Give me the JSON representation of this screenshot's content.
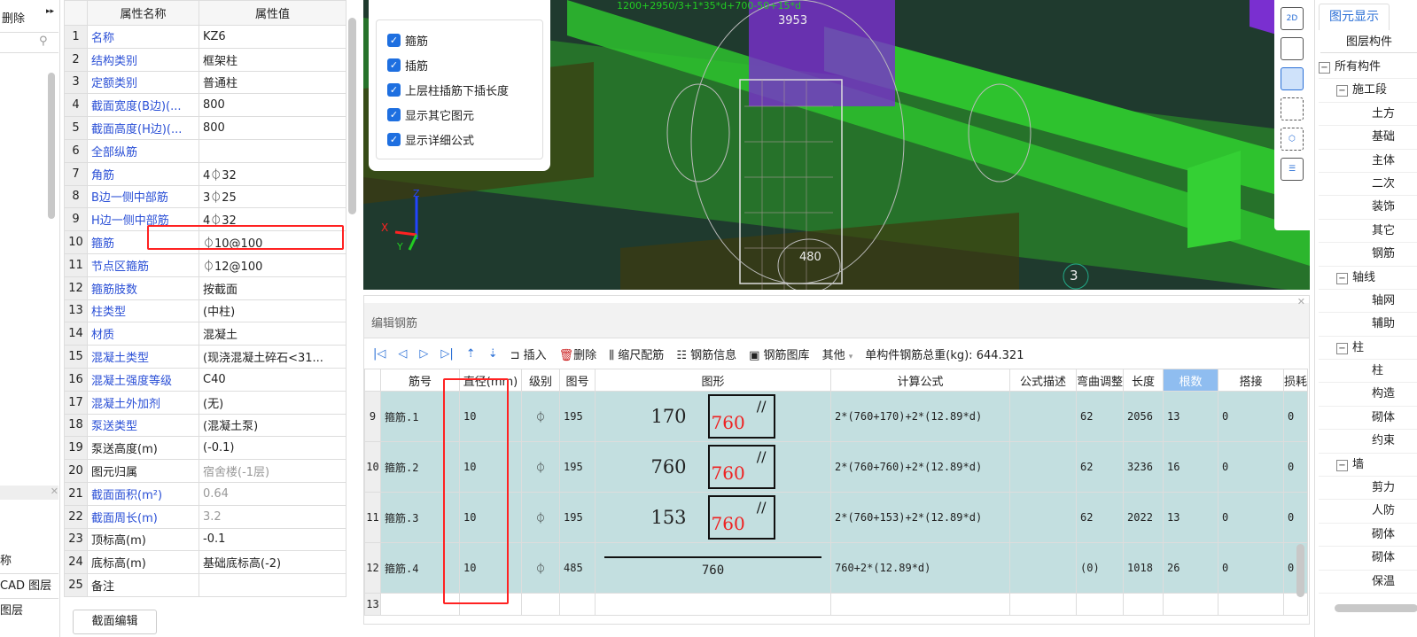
{
  "left_panel": {
    "delete_label": "删除",
    "bottom_items": [
      "称",
      "CAD 图层",
      "图层"
    ]
  },
  "props": {
    "headers": [
      "属性名称",
      "属性值"
    ],
    "rows": [
      {
        "n": "1",
        "name": "名称",
        "value": "KZ6",
        "blue": true
      },
      {
        "n": "2",
        "name": "结构类别",
        "value": "框架柱",
        "blue": true
      },
      {
        "n": "3",
        "name": "定额类别",
        "value": "普通柱",
        "blue": true
      },
      {
        "n": "4",
        "name": "截面宽度(B边)(...",
        "value": "800",
        "blue": true
      },
      {
        "n": "5",
        "name": "截面高度(H边)(...",
        "value": "800",
        "blue": true
      },
      {
        "n": "6",
        "name": "全部纵筋",
        "value": "",
        "blue": true
      },
      {
        "n": "7",
        "name": "角筋",
        "value": "4⏀32",
        "blue": true
      },
      {
        "n": "8",
        "name": "B边一侧中部筋",
        "value": "3⏀25",
        "blue": true
      },
      {
        "n": "9",
        "name": "H边一侧中部筋",
        "value": "4⏀32",
        "blue": true
      },
      {
        "n": "10",
        "name": "箍筋",
        "value": "⏀10@100",
        "blue": true
      },
      {
        "n": "11",
        "name": "节点区箍筋",
        "value": "⏀12@100",
        "blue": true
      },
      {
        "n": "12",
        "name": "箍筋肢数",
        "value": "按截面",
        "blue": true
      },
      {
        "n": "13",
        "name": "柱类型",
        "value": "(中柱)",
        "blue": true
      },
      {
        "n": "14",
        "name": "材质",
        "value": "混凝土",
        "blue": true
      },
      {
        "n": "15",
        "name": "混凝土类型",
        "value": "(现浇混凝土碎石<31...",
        "blue": true
      },
      {
        "n": "16",
        "name": "混凝土强度等级",
        "value": "C40",
        "blue": true
      },
      {
        "n": "17",
        "name": "混凝土外加剂",
        "value": "(无)",
        "blue": true
      },
      {
        "n": "18",
        "name": "泵送类型",
        "value": "(混凝土泵)",
        "blue": true
      },
      {
        "n": "19",
        "name": "泵送高度(m)",
        "value": "(-0.1)",
        "blue": false
      },
      {
        "n": "20",
        "name": "图元归属",
        "value": "宿舍楼(-1层)",
        "blue": false,
        "gray": true
      },
      {
        "n": "21",
        "name": "截面面积(m²)",
        "value": "0.64",
        "blue": true,
        "gray": true
      },
      {
        "n": "22",
        "name": "截面周长(m)",
        "value": "3.2",
        "blue": true,
        "gray": true
      },
      {
        "n": "23",
        "name": "顶标高(m)",
        "value": "-0.1",
        "blue": false
      },
      {
        "n": "24",
        "name": "底标高(m)",
        "value": "基础底标高(-2)",
        "blue": false
      },
      {
        "n": "25",
        "name": "备注",
        "value": "",
        "blue": false
      }
    ],
    "section_edit_label": "截面编辑"
  },
  "view3d": {
    "checkboxes": [
      "箍筋",
      "插筋",
      "上层柱插筋下插长度",
      "显示其它图元",
      "显示详细公式"
    ],
    "labels": {
      "top_dim": "3953",
      "bottom_dim": "480",
      "axis_no": "3",
      "formula": "1200+2950/3+1*35*d+700-50+15*d",
      "x": "X",
      "y": "Y",
      "z": "Z"
    },
    "tools": [
      "2D"
    ]
  },
  "rebar_editor": {
    "title": "编辑钢筋",
    "toolbar": {
      "insert": "插入",
      "delete": "删除",
      "scale": "缩尺配筋",
      "info": "钢筋信息",
      "library": "钢筋图库",
      "other": "其他",
      "total_label": "单构件钢筋总重(kg):",
      "total_value": "644.321"
    },
    "headers": [
      "筋号",
      "直径(mm)",
      "级别",
      "图号",
      "图形",
      "计算公式",
      "公式描述",
      "弯曲调整",
      "长度",
      "根数",
      "搭接",
      "损耗"
    ],
    "rows": [
      {
        "n": "9",
        "name": "箍筋.1",
        "dia": "10",
        "grade": "⏀",
        "fig": "195",
        "shape_a": "170",
        "shape_b": "760",
        "formula": "2*(760+170)+2*(12.89*d)",
        "desc": "",
        "bend": "62",
        "len": "2056",
        "count": "13",
        "lap": "0",
        "loss": "0"
      },
      {
        "n": "10",
        "name": "箍筋.2",
        "dia": "10",
        "grade": "⏀",
        "fig": "195",
        "shape_a": "760",
        "shape_b": "760",
        "formula": "2*(760+760)+2*(12.89*d)",
        "desc": "",
        "bend": "62",
        "len": "3236",
        "count": "16",
        "lap": "0",
        "loss": "0"
      },
      {
        "n": "11",
        "name": "箍筋.3",
        "dia": "10",
        "grade": "⏀",
        "fig": "195",
        "shape_a": "153",
        "shape_b": "760",
        "formula": "2*(760+153)+2*(12.89*d)",
        "desc": "",
        "bend": "62",
        "len": "2022",
        "count": "13",
        "lap": "0",
        "loss": "0"
      },
      {
        "n": "12",
        "name": "箍筋.4",
        "dia": "10",
        "grade": "⏀",
        "fig": "485",
        "shape_a": "760",
        "shape_b": "",
        "formula": "760+2*(12.89*d)",
        "desc": "",
        "bend": "(0)",
        "len": "1018",
        "count": "26",
        "lap": "0",
        "loss": "0"
      }
    ],
    "empty_row": "13"
  },
  "right_panel": {
    "tab": "图元显示",
    "header": "图层构件",
    "tree": [
      [
        "−",
        "所有构件",
        0
      ],
      [
        "−",
        "施工段",
        1
      ],
      [
        "",
        "土方",
        2
      ],
      [
        "",
        "基础",
        2
      ],
      [
        "",
        "主体",
        2
      ],
      [
        "",
        "二次",
        2
      ],
      [
        "",
        "装饰",
        2
      ],
      [
        "",
        "其它",
        2
      ],
      [
        "",
        "钢筋",
        2
      ],
      [
        "−",
        "轴线",
        1
      ],
      [
        "",
        "轴网",
        2
      ],
      [
        "",
        "辅助",
        2
      ],
      [
        "−",
        "柱",
        1
      ],
      [
        "",
        "柱",
        2
      ],
      [
        "",
        "构造",
        2
      ],
      [
        "",
        "砌体",
        2
      ],
      [
        "",
        "约束",
        2
      ],
      [
        "−",
        "墙",
        1
      ],
      [
        "",
        "剪力",
        2
      ],
      [
        "",
        "人防",
        2
      ],
      [
        "",
        "砌体",
        2
      ],
      [
        "",
        "砌体",
        2
      ],
      [
        "",
        "保温",
        2
      ]
    ]
  },
  "colors": {
    "accent": "#1e6fe0",
    "highlight_row": "#c3dfe0",
    "beam_green": "#2ec22e",
    "purple": "#7a2fd0",
    "red_box": "#ff2222"
  }
}
